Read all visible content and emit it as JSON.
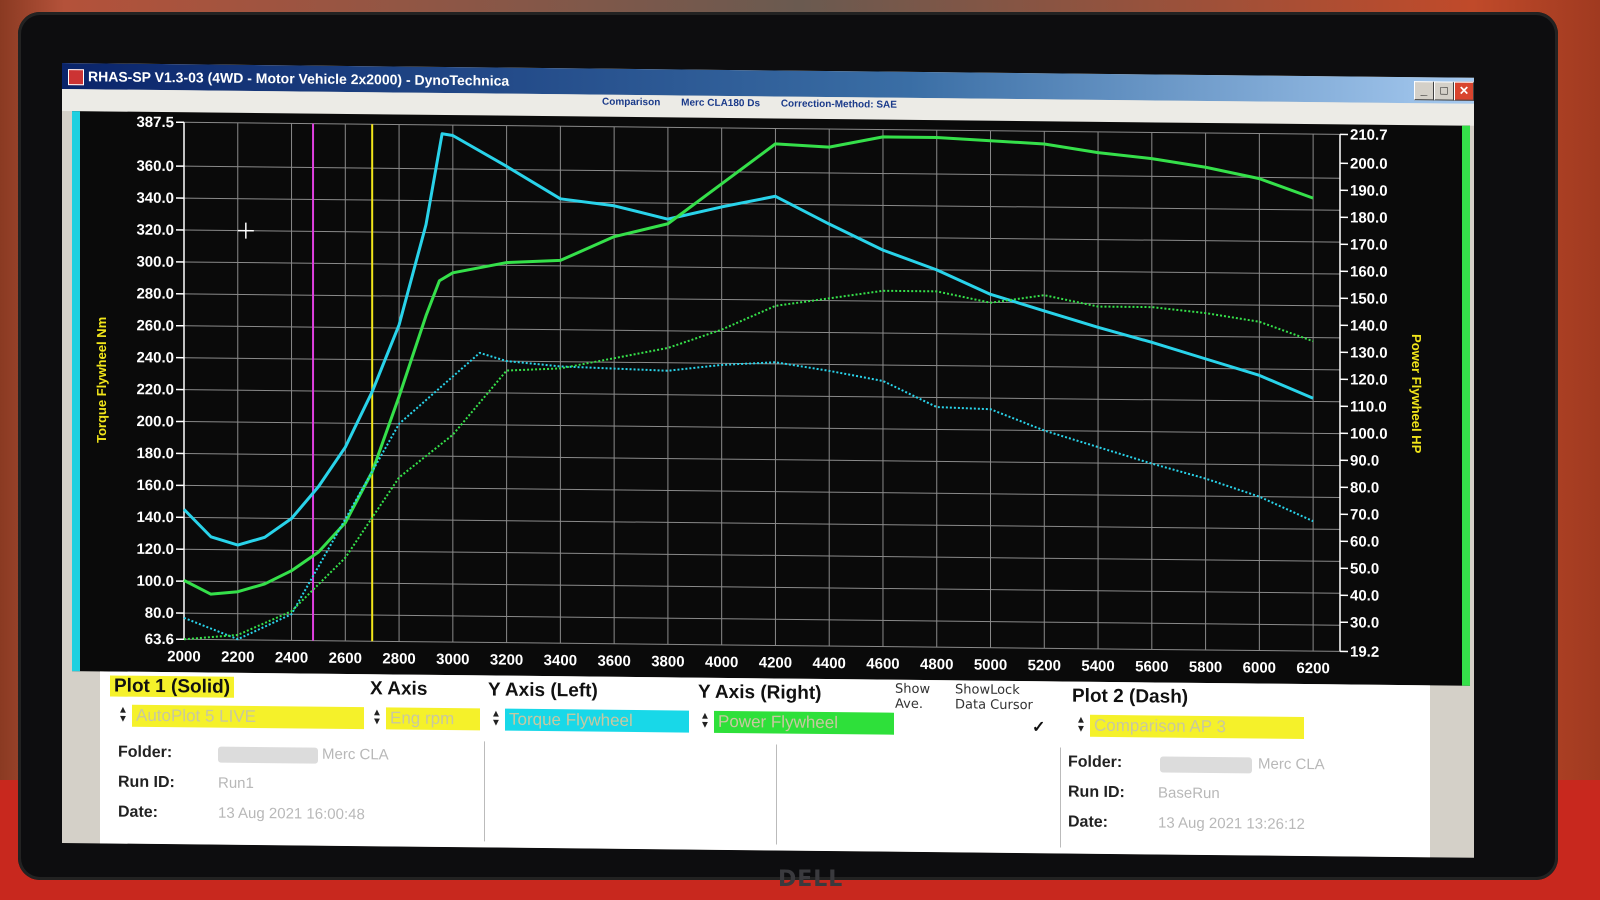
{
  "window": {
    "title": "RHAS-SP V1.3-03  (4WD - Motor Vehicle 2x2000) - DynoTechnica",
    "min": "_",
    "max": "□",
    "close": "✕"
  },
  "info": {
    "comparison": "Comparison",
    "vehicle": "Merc CLA180 Ds",
    "correction": "Correction-Method: SAE"
  },
  "cursor_icon": "crosshair-icon",
  "chart_data": {
    "type": "line",
    "xlabel": "",
    "ylabel_left": "Torque Flywheel Nm",
    "ylabel_right": "Power Flywheel HP",
    "xlim": [
      2000,
      6300
    ],
    "ylim_left": [
      63.6,
      387.5
    ],
    "ylim_right": [
      19.2,
      210.7
    ],
    "x_ticks": [
      2000,
      2200,
      2400,
      2600,
      2800,
      3000,
      3200,
      3400,
      3600,
      3800,
      4000,
      4200,
      4400,
      4600,
      4800,
      5000,
      5200,
      5400,
      5600,
      5800,
      6000,
      6200
    ],
    "y_left_ticks": [
      "387.5",
      "360.0",
      "340.0",
      "320.0",
      "300.0",
      "280.0",
      "260.0",
      "240.0",
      "220.0",
      "200.0",
      "180.0",
      "160.0",
      "140.0",
      "120.0",
      "100.0",
      "80.0",
      "63.6"
    ],
    "y_right_ticks": [
      "210.7",
      "200.0",
      "190.0",
      "180.0",
      "170.0",
      "160.0",
      "150.0",
      "140.0",
      "130.0",
      "120.0",
      "110.0",
      "100.0",
      "90.0",
      "80.0",
      "70.0",
      "60.0",
      "50.0",
      "40.0",
      "30.0",
      "19.2"
    ],
    "grid": true,
    "markers": [
      {
        "x": 2480,
        "color": "#e040e0"
      },
      {
        "x": 2700,
        "color": "#f2e61a"
      }
    ],
    "series": [
      {
        "name": "Torque Flywheel",
        "axis": "left",
        "style": "solid",
        "color": "#29d3ea",
        "x": [
          2000,
          2100,
          2200,
          2300,
          2400,
          2500,
          2600,
          2700,
          2800,
          2900,
          2960,
          3000,
          3200,
          3400,
          3600,
          3800,
          4000,
          4200,
          4400,
          4600,
          4800,
          5000,
          5200,
          5400,
          5600,
          5800,
          6000,
          6200
        ],
        "y": [
          145,
          128,
          123,
          128,
          140,
          160,
          185,
          220,
          262,
          325,
          382,
          381,
          362,
          342,
          338,
          330,
          338,
          345,
          328,
          312,
          300,
          285,
          275,
          265,
          256,
          246,
          236,
          222
        ]
      },
      {
        "name": "Power Flywheel",
        "axis": "right",
        "style": "solid",
        "color": "#35e04a",
        "x": [
          2000,
          2100,
          2200,
          2300,
          2400,
          2500,
          2600,
          2700,
          2800,
          2900,
          2950,
          3000,
          3200,
          3400,
          3600,
          3800,
          4000,
          4200,
          4400,
          4600,
          4800,
          5000,
          5200,
          5400,
          5600,
          5800,
          6000,
          6200
        ],
        "y": [
          41,
          36,
          37,
          40,
          45,
          52,
          63,
          82,
          110,
          140,
          153,
          156,
          160,
          161,
          170,
          175,
          190,
          205,
          204,
          208,
          208,
          207,
          206,
          203,
          201,
          198,
          194,
          187
        ]
      },
      {
        "name": "Comparison Torque Flywheel",
        "axis": "left",
        "style": "dash",
        "color": "#29d3ea",
        "x": [
          2000,
          2200,
          2400,
          2600,
          2800,
          3000,
          3100,
          3200,
          3400,
          3600,
          3800,
          4000,
          4200,
          4400,
          4600,
          4800,
          5000,
          5200,
          5400,
          5600,
          5800,
          6000,
          6200
        ],
        "y": [
          77,
          64,
          80,
          140,
          200,
          230,
          245,
          240,
          237,
          236,
          235,
          239,
          241,
          236,
          230,
          214,
          213,
          200,
          190,
          180,
          171,
          160,
          145
        ]
      },
      {
        "name": "Comparison Power Flywheel",
        "axis": "right",
        "style": "dash",
        "color": "#35e04a",
        "x": [
          2000,
          2200,
          2400,
          2600,
          2800,
          3000,
          3200,
          3400,
          3600,
          3800,
          4000,
          4200,
          4400,
          4600,
          4800,
          5000,
          5200,
          5400,
          5600,
          5800,
          6000,
          6200
        ],
        "y": [
          19.2,
          21,
          30,
          50,
          80,
          96,
          120,
          121,
          125,
          129,
          136,
          145,
          148,
          151,
          151,
          147,
          150,
          146,
          146,
          144,
          141,
          134
        ]
      }
    ]
  },
  "controls": {
    "plot1_label": "Plot 1 (Solid)",
    "x_axis_label": "X Axis",
    "y_left_label": "Y Axis (Left)",
    "y_right_label": "Y Axis (Right)",
    "show_ave": "Show\nAve.",
    "showlock": "ShowLock\nData Cursor",
    "plot2_label": "Plot 2 (Dash)",
    "plot1_value": "AutoPlot 5 LIVE",
    "x_value": "Eng rpm",
    "y_left_value": "Torque Flywheel",
    "y_right_value": "Power Flywheel",
    "check": "✓",
    "plot2_value": "Comparison AP 3",
    "folder_key": "Folder:",
    "runid_key": "Run ID:",
    "date_key": "Date:",
    "plot1_folder": "Merc CLA",
    "plot1_runid": "Run1",
    "plot1_date": "13 Aug 2021  16:00:48",
    "plot2_folder": "Merc CLA",
    "plot2_runid": "BaseRun",
    "plot2_date": "13 Aug 2021  13:26:12",
    "colors": {
      "plot_select": "#f5f12a",
      "torque": "#18d8e8",
      "power": "#2ee03a"
    }
  },
  "monitor_brand": "DELL"
}
